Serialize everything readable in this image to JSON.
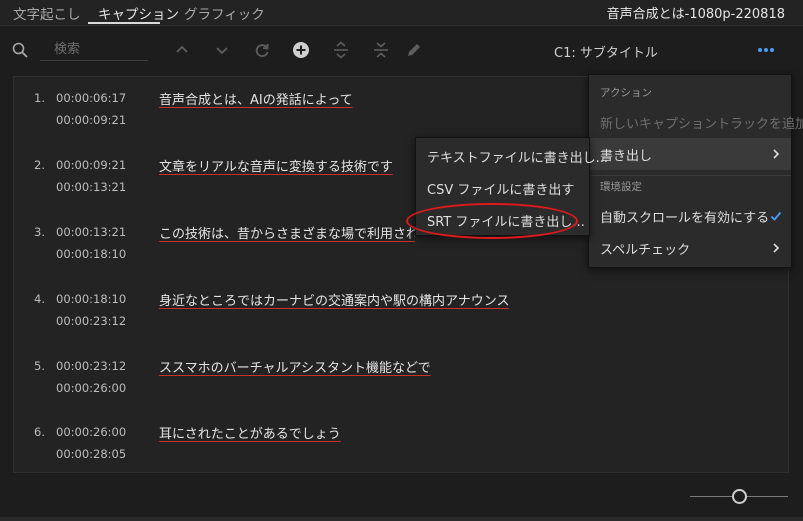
{
  "tabs": [
    {
      "label": "文字起こし"
    },
    {
      "label": "キャプション"
    },
    {
      "label": "グラフィック"
    }
  ],
  "window_title": "音声合成とは-1080p-220818",
  "search": {
    "placeholder": "検索",
    "value": ""
  },
  "track_label": "C1: サブタイトル",
  "icons": {
    "search": "search-icon",
    "prev": "chevron-up-icon",
    "next": "chevron-down-icon",
    "refresh": "refresh-icon",
    "add": "add-icon",
    "split": "split-icon",
    "merge": "merge-icon",
    "edit": "pencil-icon",
    "more": "more-icon"
  },
  "captions": [
    {
      "num": "1.",
      "in": "00:00:06:17",
      "out": "00:00:09:21",
      "text": "音声合成とは、AIの発話によって"
    },
    {
      "num": "2.",
      "in": "00:00:09:21",
      "out": "00:00:13:21",
      "text": "文章をリアルな音声に変換する技術です"
    },
    {
      "num": "3.",
      "in": "00:00:13:21",
      "out": "00:00:18:10",
      "text": "この技術は、昔からさまざまな場で利用されてお"
    },
    {
      "num": "4.",
      "in": "00:00:18:10",
      "out": "00:00:23:12",
      "text": "身近なところではカーナビの交通案内や駅の構内アナウンス"
    },
    {
      "num": "5.",
      "in": "00:00:23:12",
      "out": "00:00:26:00",
      "text": "ススマホのバーチャルアシスタント機能などで"
    },
    {
      "num": "6.",
      "in": "00:00:26:00",
      "out": "00:00:28:05",
      "text": "耳にされたことがあるでしょう"
    }
  ],
  "main_menu": {
    "action_header": "アクション",
    "add_track": "新しいキャプショントラックを追加...",
    "export": "書き出し",
    "env_header": "環境設定",
    "autoscroll": "自動スクロールを有効にする",
    "spellcheck": "スペルチェック"
  },
  "export_submenu": {
    "text_file": "テキストファイルに書き出し...",
    "csv_file": "CSV ファイルに書き出す",
    "srt_file": "SRT ファイルに書き出し..."
  },
  "colors": {
    "accent_blue": "#4b9cf5",
    "annotation_red": "#e01a1a",
    "spell_underline": "#c9302c"
  }
}
